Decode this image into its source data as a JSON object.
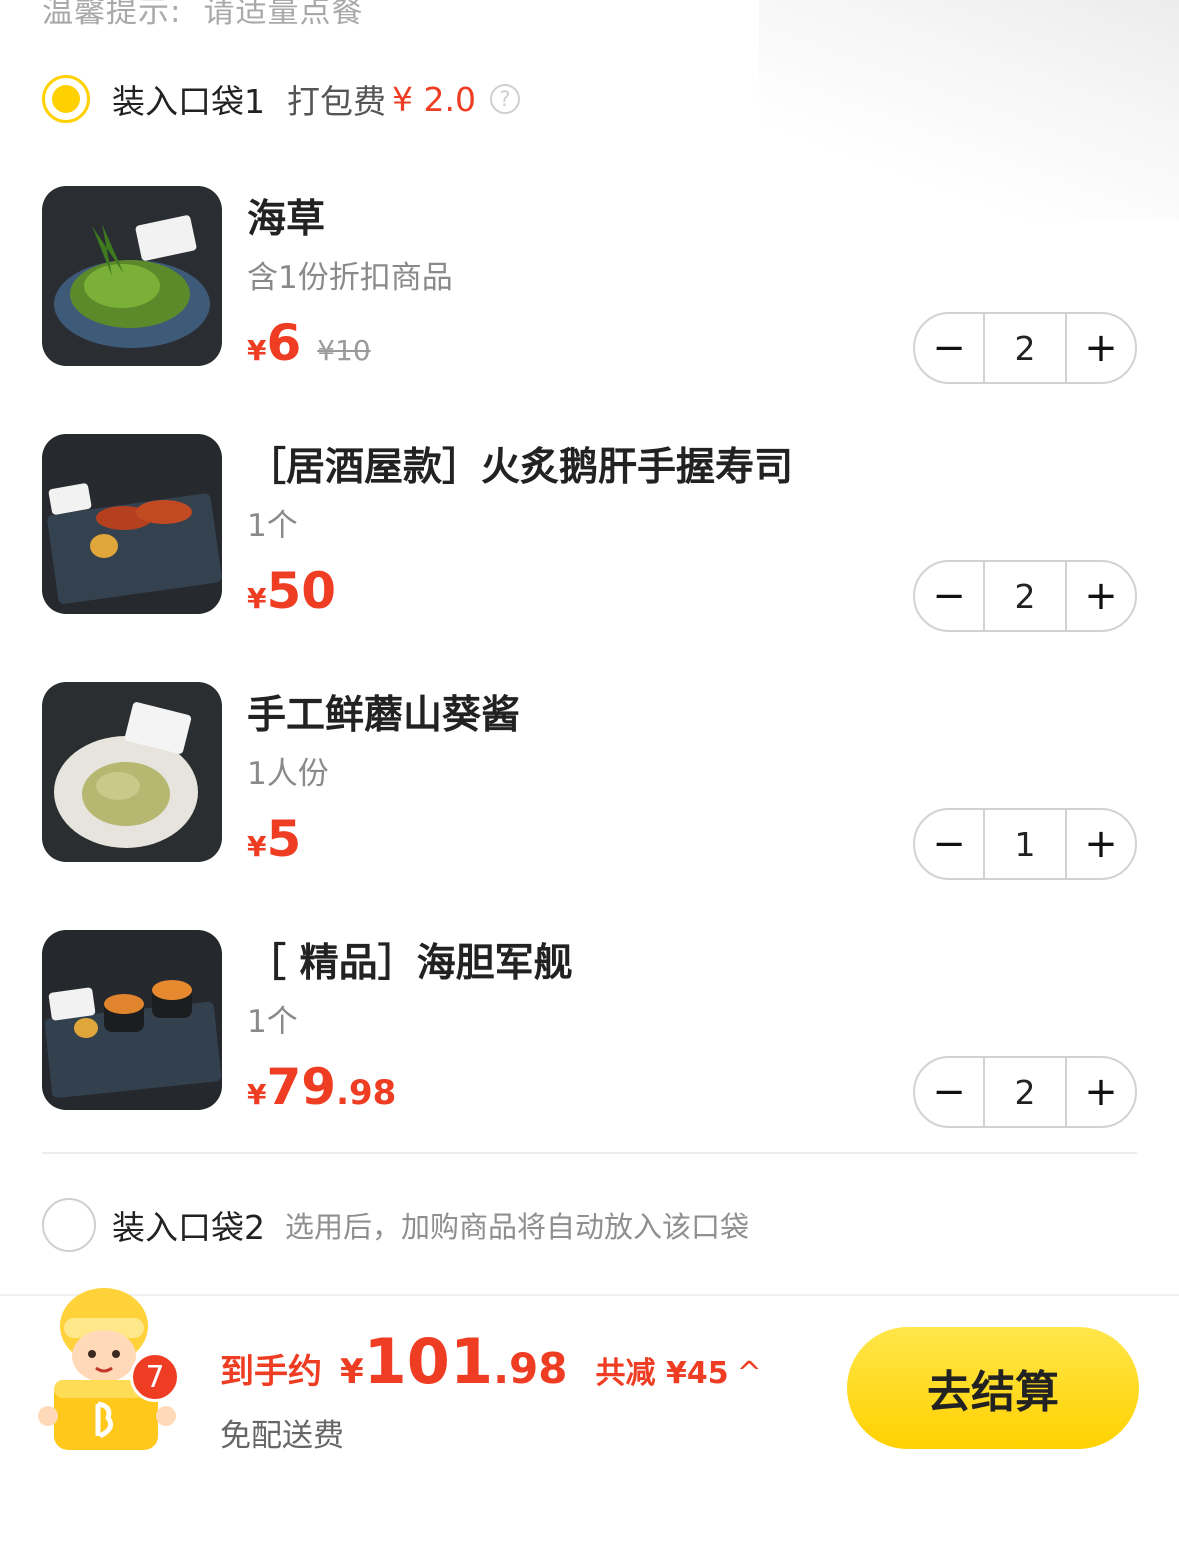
{
  "tip": {
    "label": "温馨提示:",
    "text": "请适量点餐"
  },
  "bag1": {
    "label": "装入口袋1",
    "fee_label": "打包费",
    "fee_amount": "¥ 2.0",
    "help": "?"
  },
  "items": [
    {
      "name": "海草",
      "spec": "含1份折扣商品",
      "currency": "¥",
      "price_int": "6",
      "price_dec": "",
      "original_price": "¥10",
      "qty": "2"
    },
    {
      "name": "［居酒屋款］火炙鹅肝手握寿司",
      "spec": "1个",
      "currency": "¥",
      "price_int": "50",
      "price_dec": "",
      "original_price": "",
      "qty": "2"
    },
    {
      "name": "手工鲜蘑山葵酱",
      "spec": "1人份",
      "currency": "¥",
      "price_int": "5",
      "price_dec": "",
      "original_price": "",
      "qty": "1"
    },
    {
      "name": "［ 精品］海胆军舰",
      "spec": "1个",
      "currency": "¥",
      "price_int": "79",
      "price_dec": ".98",
      "original_price": "",
      "qty": "2"
    }
  ],
  "stepper": {
    "minus": "−",
    "plus": "+"
  },
  "bag2": {
    "label": "装入口袋2",
    "hint": "选用后，加购商品将自动放入该口袋"
  },
  "cart": {
    "badge_count": "7",
    "total_label": "到手约",
    "total_currency": "¥",
    "total_int": "101",
    "total_dec": ".98",
    "discount": "共减 ¥45",
    "chevron": "^",
    "delivery": "免配送费",
    "checkout": "去结算"
  },
  "colors": {
    "accent_yellow": "#ffd100",
    "price_red": "#ee3d23"
  },
  "icons": [
    "radio-selected-icon",
    "help-icon",
    "minus-icon",
    "plus-icon",
    "radio-empty-icon",
    "chevron-up-icon",
    "cart-mascot-icon"
  ]
}
